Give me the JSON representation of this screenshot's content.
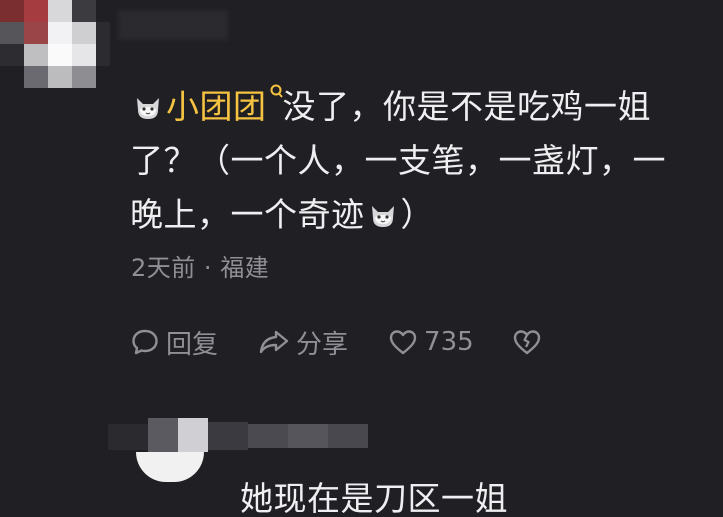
{
  "comment": {
    "username": "小团团",
    "line1_text": "没了，你是不是吃鸡一姐",
    "line2_text": "了？（一个人，一支笔，一盏灯，一",
    "line3_text_a": "晚上，一个奇迹",
    "line3_text_b": "）",
    "emoji_name": "cat-face-icon"
  },
  "meta": {
    "time": "2天前",
    "separator": "·",
    "location": "福建"
  },
  "actions": {
    "reply_label": "回复",
    "share_label": "分享",
    "like_count": "735"
  },
  "reply": {
    "text": "她现在是刀区一姐"
  },
  "colors": {
    "background": "#1f1f24",
    "username": "#f5c341",
    "secondary": "#8f8f95",
    "text": "#efeff1"
  }
}
